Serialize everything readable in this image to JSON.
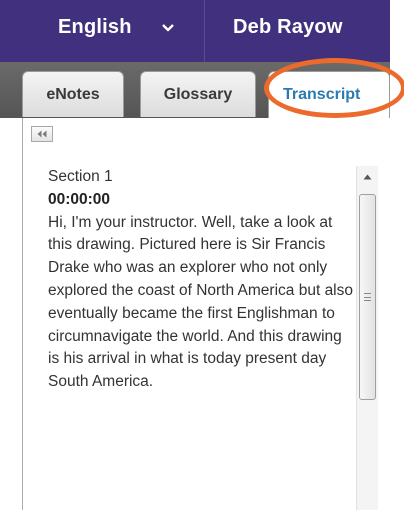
{
  "header": {
    "language": "English",
    "user_name": "Deb Rayow",
    "background_color": "#40307d"
  },
  "tabs": [
    {
      "label": "eNotes",
      "active": false
    },
    {
      "label": "Glossary",
      "active": false
    },
    {
      "label": "Transcript",
      "active": true
    }
  ],
  "highlight_color": "#ec6a2c",
  "collapse_button": {
    "icon": "double-left-arrow-icon"
  },
  "transcript": {
    "section": "Section 1",
    "timestamp": "00:00:00",
    "text": "Hi, I'm your instructor. Well, take a look at this drawing. Pictured here is Sir Francis Drake who was an explorer who not only explored the coast of North America but also eventually became the first Englishman to circumnavigate the world. And this drawing is his arrival in what is today present day South America."
  },
  "scrollbar": {
    "up_icon": "scroll-up-arrow-icon"
  }
}
